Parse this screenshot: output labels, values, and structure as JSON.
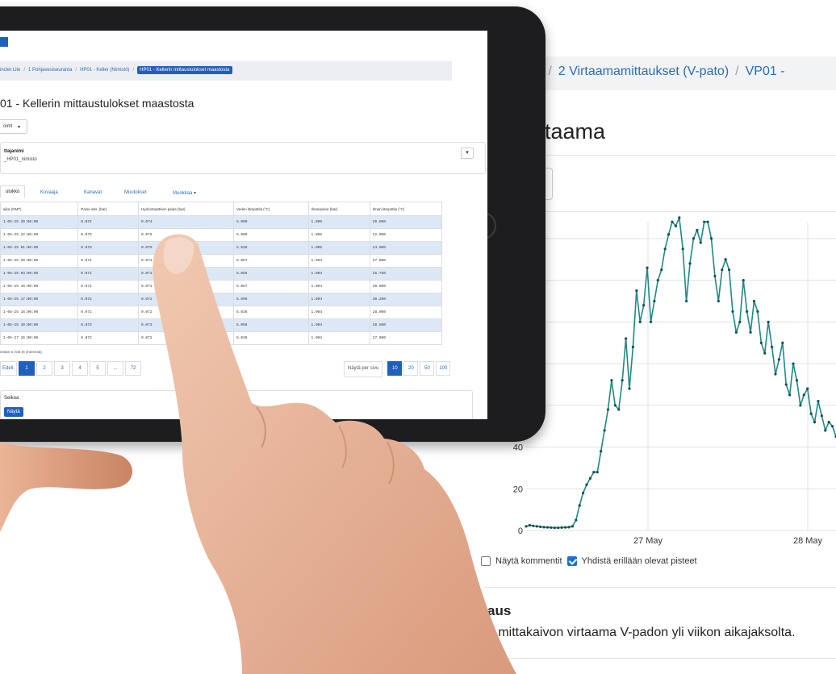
{
  "background_page": {
    "breadcrumb": [
      "te",
      "2 Virtaamamittaukset (V-pato)",
      "VP01 -"
    ],
    "title": "irtaama",
    "checkbox_comments": {
      "label": "Näytä kommentit",
      "checked": false
    },
    "checkbox_connect": {
      "label": "Yhdistä erillään olevat pisteet",
      "checked": true
    },
    "description_heading": "aus",
    "description_text": "1 mittakaivon virtaama V-padon yli viikon aikajaksolta."
  },
  "chart_data": {
    "type": "line",
    "x_ticks": [
      "27 May",
      "28 May"
    ],
    "y_ticks": [
      "0",
      "20",
      "40"
    ],
    "ylim": [
      0,
      150
    ],
    "grid": true,
    "color": "#1e8a86",
    "series": [
      {
        "values": [
          2,
          2.5,
          2.2,
          2,
          1.8,
          1.6,
          1.5,
          1.4,
          1.3,
          1.3,
          1.4,
          1.5,
          1.6,
          2,
          5,
          12,
          18,
          22,
          25,
          28,
          28,
          38,
          48,
          58,
          72,
          60,
          58,
          72,
          92,
          68,
          88,
          115,
          100,
          108,
          126,
          100,
          110,
          120,
          125,
          135,
          142,
          148,
          146,
          150,
          135,
          110,
          128,
          140,
          144,
          138,
          148,
          148,
          140,
          122,
          110,
          125,
          130,
          125,
          105,
          95,
          100,
          120,
          105,
          95,
          110,
          105,
          90,
          85,
          100,
          88,
          75,
          82,
          90,
          70,
          65,
          80,
          72,
          60,
          65,
          68,
          56,
          52,
          62,
          55,
          48,
          52,
          50,
          45
        ]
      }
    ]
  },
  "tablet": {
    "breadcrumb": [
      "inclet Lite",
      "1 Pohjavesiseuranta",
      "HP01 - Keller (Nimistö)"
    ],
    "breadcrumb_active": "HP01 - Kellerin mittaustulokset maastosta",
    "title": "01 - Kellerin mittaustulokset maastosta",
    "dropdown": "oimt",
    "panel_label": "ttajanimi",
    "panel_value": "_HP01_nimisto",
    "tabs": [
      "ulukko",
      "Kuvaaja",
      "Kanavat",
      "Muutokset",
      "Muokkaa"
    ],
    "columns": [
      "aika (GMT)",
      "Paine abs. (bar)",
      "Hydrostaattinen paine (bar)",
      "Veden lämpötila (°C)",
      "Ilmanpaine (bar)",
      "Ilman lämpötila (°C)"
    ],
    "rows": [
      [
        "1-05-25 20:00:00",
        "0.074",
        "0.074",
        "5.000",
        "1.005",
        "20.000"
      ],
      [
        "1-05-25 22:00:00",
        "0.075",
        "0.075",
        "5.000",
        "1.005",
        "22.000"
      ],
      [
        "1-05-25 01:00:00",
        "0.079",
        "0.079",
        "5.036",
        "1.005",
        "24.000"
      ],
      [
        "1-05-25 20:00:00",
        "0.071",
        "0.071",
        "5.067",
        "1.004",
        "27.000"
      ],
      [
        "1-05-25 04:00:00",
        "0.071",
        "0.071",
        "5.058",
        "1.004",
        "25.750"
      ],
      [
        "1-05-25 16:00:00",
        "0.071",
        "0.071",
        "5.067",
        "1.004",
        "30.000"
      ],
      [
        "1-05-25 17:00:00",
        "0.072",
        "0.072",
        "5.000",
        "1.004",
        "30.200"
      ],
      [
        "1-05-25 16:00:00",
        "0.072",
        "0.072",
        "5.036",
        "1.004",
        "28.000"
      ],
      [
        "1-05-25 10:00:00",
        "0.073",
        "0.073",
        "5.058",
        "1.004",
        "28.500"
      ],
      [
        "1-05-27 16:00:00",
        "0.072",
        "0.072",
        "5.036",
        "1.004",
        "27.000"
      ]
    ],
    "row_count_text": "ietään 5 riviä (5 yhteensä)",
    "pager": [
      "Edell.",
      "1",
      "2",
      "3",
      "4",
      "5",
      "...",
      "72"
    ],
    "per_page_label": "Näytä per sivu",
    "per_page": [
      "10",
      "20",
      "50",
      "100"
    ],
    "panel2_label": "Seikoa",
    "panel2_button": "Näytä"
  }
}
